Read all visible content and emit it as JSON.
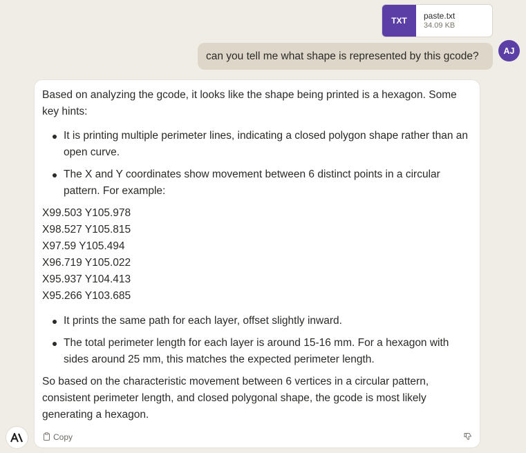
{
  "attachment": {
    "type_label": "TXT",
    "file_name": "paste.txt",
    "file_size": "34.09 KB",
    "icon": "file-icon",
    "accent_color": "#5b3fa6"
  },
  "user": {
    "initials": "AJ",
    "message": "can you tell me what shape is represented by this gcode?"
  },
  "assistant": {
    "intro": "Based on analyzing the gcode, it looks like the shape being printed is a hexagon. Some key hints:",
    "bullets_top": [
      "It is printing multiple perimeter lines, indicating a closed polygon shape rather than an open curve.",
      "The X and Y coordinates show movement between 6 distinct points in a circular pattern. For example:"
    ],
    "coordinates": [
      "X99.503 Y105.978",
      "X98.527 Y105.815",
      "X97.59 Y105.494",
      "X96.719 Y105.022",
      "X95.937 Y104.413",
      "X95.266 Y103.685"
    ],
    "bullets_bottom": [
      "It prints the same path for each layer, offset slightly inward.",
      "The total perimeter length for each layer is around 15-16 mm. For a hexagon with sides around 25 mm, this matches the expected perimeter length."
    ],
    "conclusion": "So based on the characteristic movement between 6 vertices in a circular pattern, consistent perimeter length, and closed polygonal shape, the gcode is most likely generating a hexagon.",
    "copy_label": "Copy",
    "copy_icon": "clipboard-icon",
    "feedback_icon": "thumbs-down-icon"
  },
  "brand": {
    "logo": "anthropic-logo-icon"
  }
}
